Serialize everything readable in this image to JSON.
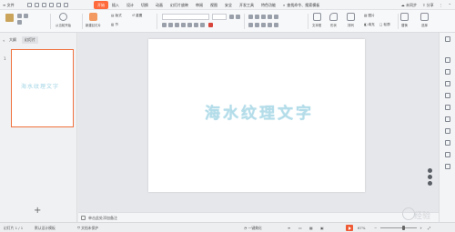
{
  "menubar": {
    "file_label": "文件",
    "tabs": [
      {
        "label": "开始",
        "active": true
      },
      {
        "label": "插入",
        "active": false
      },
      {
        "label": "设计",
        "active": false
      },
      {
        "label": "切换",
        "active": false
      },
      {
        "label": "动画",
        "active": false
      },
      {
        "label": "幻灯片放映",
        "active": false
      },
      {
        "label": "审阅",
        "active": false
      },
      {
        "label": "视图",
        "active": false
      },
      {
        "label": "安全",
        "active": false
      },
      {
        "label": "开发工具",
        "active": false
      },
      {
        "label": "特色功能",
        "active": false
      }
    ],
    "search_label": "查找命令、搜索模板",
    "sync_label": "未同步",
    "share_label": "分享"
  },
  "ribbon": {
    "new_slide": "新建幻灯片",
    "from_start": "从当前开始",
    "layout": "版式",
    "section": "节",
    "reset": "重置",
    "textbox": "文本框",
    "shape": "形状",
    "arrange": "排列",
    "image": "图片",
    "fill": "填充",
    "outline": "轮廓",
    "replace": "替换",
    "select": "选择"
  },
  "leftpanel": {
    "tab_outline": "大纲",
    "tab_slides": "幻灯片",
    "slide_number": "1",
    "thumb_text": "海水纹理文字"
  },
  "slide": {
    "title": "海水纹理文字"
  },
  "notes": {
    "placeholder": "单击此处添加备注"
  },
  "status": {
    "page": "幻灯片 1 / 1",
    "theme": "默认设计模板",
    "doc_protect": "文档未保护",
    "beautify": "一键美化",
    "zoom": "67%",
    "watermark": "经验"
  },
  "colors": {
    "accent": "#ff6a3d",
    "title_text": "#b4dde9"
  }
}
